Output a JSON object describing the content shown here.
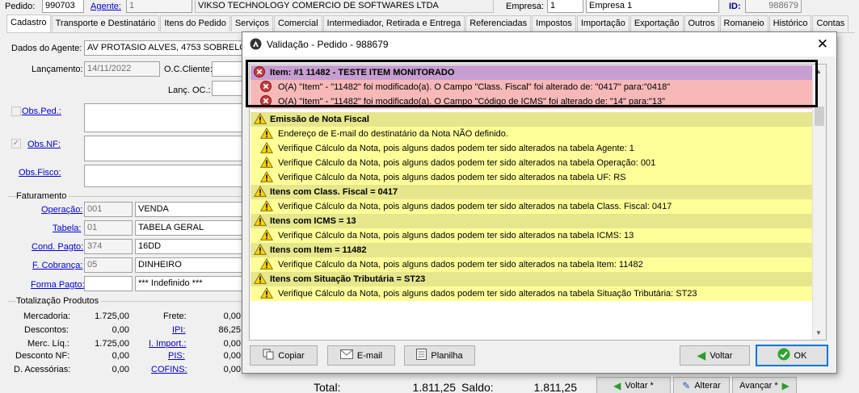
{
  "header": {
    "pedido_label": "Pedido:",
    "pedido_value": "990703",
    "agente_label": "Agente:",
    "agente_value": "1",
    "company_name": "VIKSO TECHNOLOGY COMERCIO DE SOFTWARES LTDA",
    "empresa_label": "Empresa:",
    "empresa_value": "1",
    "empresa_name": "Empresa 1",
    "id_label": "ID:",
    "id_value": "988679"
  },
  "tabs": [
    "Cadastro",
    "Transporte e Destinatário",
    "Itens do Pedido",
    "Serviços",
    "Comercial",
    "Intermediador, Retirada e Entrega",
    "Referenciadas",
    "Impostos",
    "Importação",
    "Exportação",
    "Outros",
    "Romaneio",
    "Histórico",
    "Contas"
  ],
  "form": {
    "dados_agente_label": "Dados do Agente:",
    "dados_agente_value": "AV PROTASIO ALVES, 4753 SOBRELOJA",
    "lancamento_label": "Lançamento:",
    "lancamento_value": "14/11/2022",
    "oc_cliente_label": "O.C.Cliente:",
    "lanc_oc_label": "Lanç. OC.:",
    "obs_ped_label": "Obs.Ped.:",
    "obs_nf_label": "Obs.NF:",
    "obs_fisco_label": "Obs.Fisco:"
  },
  "faturamento": {
    "title": "Faturamento",
    "operacao_label": "Operação:",
    "operacao_code": "001",
    "operacao_name": "VENDA",
    "tabela_label": "Tabela:",
    "tabela_code": "01",
    "tabela_name": "TABELA GERAL",
    "cond_pagto_label": "Cond. Pagto:",
    "cond_pagto_code": "374",
    "cond_pagto_name": "16DD",
    "f_cobranca_label": "F. Cobrança:",
    "f_cobranca_code": "05",
    "f_cobranca_name": "DINHEIRO",
    "forma_pagto_label": "Forma Pagto:",
    "forma_pagto_name": "*** Indefinido ***"
  },
  "totalizacao": {
    "title": "Totalização Produtos",
    "mercadoria_label": "Mercadoria:",
    "mercadoria_value": "1.725,00",
    "descontos_label": "Descontos:",
    "descontos_value": "0,00",
    "merc_liq_label": "Merc. Líq.:",
    "merc_liq_value": "1.725,00",
    "desconto_nf_label": "Desconto NF:",
    "desconto_nf_value": "0,00",
    "d_acessorias_label": "D. Acessórias:",
    "d_acessorias_value": "0,00",
    "frete_label": "Frete:",
    "frete_value": "0,00",
    "ipi_label": "IPI:",
    "ipi_value": "86,25",
    "i_import_label": "I. Import.:",
    "i_import_value": "0,00",
    "pis_label": "PIS:",
    "pis_value": "0,00",
    "cofins_label": "COFINS:",
    "cofins_value": "0,00"
  },
  "footer": {
    "total_label": "Total:",
    "total_value": "1.811,25",
    "saldo_label": "Saldo:",
    "saldo_value": "1.811,25",
    "voltar_label": "Voltar *",
    "alterar_label": "Alterar",
    "avancar_label": "Avançar *"
  },
  "dialog": {
    "title": "Validação - Pedido - 988679",
    "rows": [
      {
        "kind": "error-header",
        "text": "Item: #1 11482 - TESTE ITEM MONITORADO"
      },
      {
        "kind": "error",
        "text": "O(A) \"Item\" -  \"11482\" foi modificado(a). O Campo \"Class. Fiscal\" foi alterado de: \"0417\" para:\"0418\""
      },
      {
        "kind": "error",
        "text": "O(A) \"Item\" -  \"11482\" foi modificado(a). O Campo \"Código de ICMS\" foi alterado de: \"14\" para:\"13\""
      },
      {
        "kind": "warn-header",
        "text": "Emissão de Nota Fiscal"
      },
      {
        "kind": "warn",
        "text": "Endereço de E-mail do destinatário da Nota NÃO definido."
      },
      {
        "kind": "warn",
        "text": "Verifique Cálculo da Nota, pois alguns dados podem ter sido alterados na tabela Agente: 1"
      },
      {
        "kind": "warn",
        "text": "Verifique Cálculo da Nota, pois alguns dados podem ter sido alterados na tabela Operação: 001"
      },
      {
        "kind": "warn",
        "text": "Verifique Cálculo da Nota, pois alguns dados podem ter sido alterados na tabela UF: RS"
      },
      {
        "kind": "warn-header",
        "text": "Itens com Class. Fiscal = 0417"
      },
      {
        "kind": "warn",
        "text": "Verifique Cálculo da Nota, pois alguns dados podem ter sido alterados na tabela Class. Fiscal: 0417"
      },
      {
        "kind": "warn-header",
        "text": "Itens com ICMS = 13"
      },
      {
        "kind": "warn",
        "text": "Verifique Cálculo da Nota, pois alguns dados podem ter sido alterados na tabela ICMS: 13"
      },
      {
        "kind": "warn-header",
        "text": "Itens com Item = 11482"
      },
      {
        "kind": "warn",
        "text": "Verifique Cálculo da Nota, pois alguns dados podem ter sido alterados na tabela Item: 11482"
      },
      {
        "kind": "warn-header",
        "text": "Itens com Situação Tributária = ST23"
      },
      {
        "kind": "warn",
        "text": "Verifique Cálculo da Nota, pois alguns dados podem ter sido alterados na tabela Situação Tributária: ST23"
      }
    ],
    "buttons": {
      "copiar": "Copiar",
      "email": "E-mail",
      "planilha": "Planilha",
      "voltar": "Voltar",
      "ok": "OK"
    }
  },
  "colors": {
    "error_header_bg": "#c79ed0",
    "error_row_bg": "#f7b8b8",
    "warn_header_bg": "#e6e68c",
    "warn_row_bg": "#ffff99",
    "link": "#0000cc",
    "ok_border": "#0078d7"
  }
}
